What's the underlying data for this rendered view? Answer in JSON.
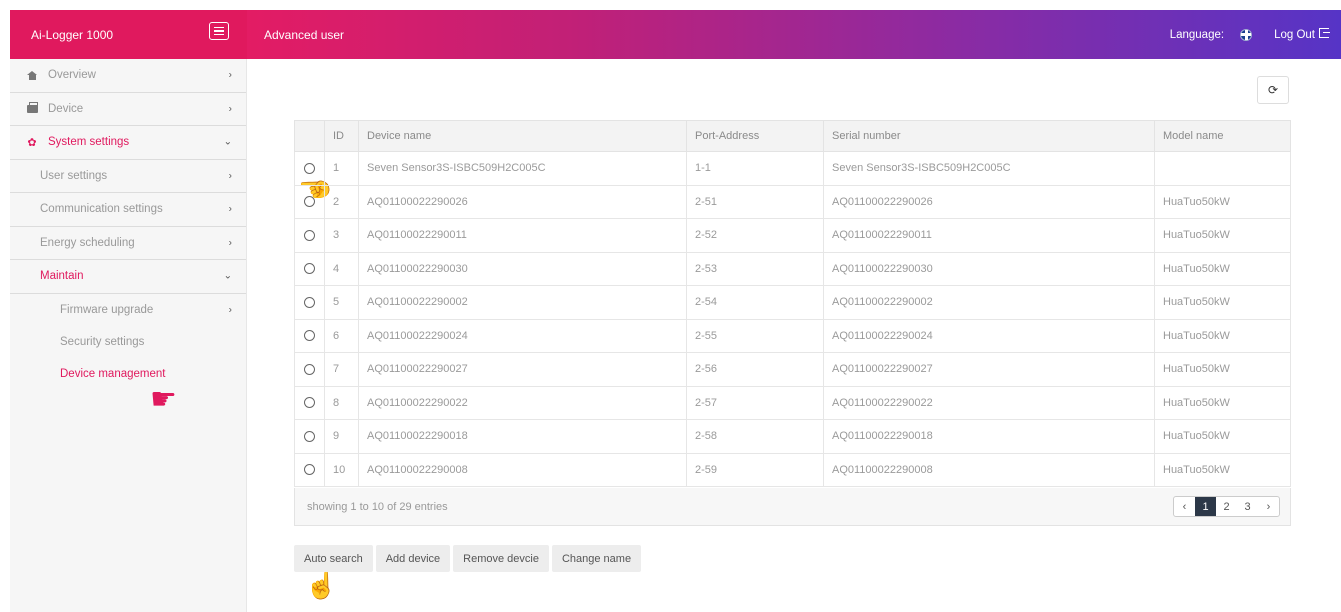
{
  "header": {
    "brand": "Ai-Logger 1000",
    "user_role": "Advanced user",
    "language_label": "Language:",
    "logout_label": "Log Out"
  },
  "sidebar": {
    "items": [
      {
        "label": "Overview"
      },
      {
        "label": "Device"
      },
      {
        "label": "System settings"
      },
      {
        "label": "User settings"
      },
      {
        "label": "Communication settings"
      },
      {
        "label": "Energy scheduling"
      },
      {
        "label": "Maintain"
      },
      {
        "label": "Firmware upgrade"
      },
      {
        "label": "Security settings"
      },
      {
        "label": "Device management"
      }
    ]
  },
  "table": {
    "columns": [
      "ID",
      "Device name",
      "Port-Address",
      "Serial number",
      "Model name"
    ],
    "rows": [
      {
        "id": "1",
        "name": "Seven Sensor3S-ISBC509H2C005C",
        "port": "1-1",
        "serial": "Seven Sensor3S-ISBC509H2C005C",
        "model": ""
      },
      {
        "id": "2",
        "name": "AQ01100022290026",
        "port": "2-51",
        "serial": "AQ01100022290026",
        "model": "HuaTuo50kW"
      },
      {
        "id": "3",
        "name": "AQ01100022290011",
        "port": "2-52",
        "serial": "AQ01100022290011",
        "model": "HuaTuo50kW"
      },
      {
        "id": "4",
        "name": "AQ01100022290030",
        "port": "2-53",
        "serial": "AQ01100022290030",
        "model": "HuaTuo50kW"
      },
      {
        "id": "5",
        "name": "AQ01100022290002",
        "port": "2-54",
        "serial": "AQ01100022290002",
        "model": "HuaTuo50kW"
      },
      {
        "id": "6",
        "name": "AQ01100022290024",
        "port": "2-55",
        "serial": "AQ01100022290024",
        "model": "HuaTuo50kW"
      },
      {
        "id": "7",
        "name": "AQ01100022290027",
        "port": "2-56",
        "serial": "AQ01100022290027",
        "model": "HuaTuo50kW"
      },
      {
        "id": "8",
        "name": "AQ01100022290022",
        "port": "2-57",
        "serial": "AQ01100022290022",
        "model": "HuaTuo50kW"
      },
      {
        "id": "9",
        "name": "AQ01100022290018",
        "port": "2-58",
        "serial": "AQ01100022290018",
        "model": "HuaTuo50kW"
      },
      {
        "id": "10",
        "name": "AQ01100022290008",
        "port": "2-59",
        "serial": "AQ01100022290008",
        "model": "HuaTuo50kW"
      }
    ]
  },
  "pagination": {
    "summary": "showing 1 to 10 of 29 entries",
    "prev": "‹",
    "pages": [
      "1",
      "2",
      "3"
    ],
    "next": "›",
    "current": "1"
  },
  "actions": {
    "auto_search": "Auto search",
    "add_device": "Add device",
    "remove_device": "Remove devcie",
    "change_name": "Change name"
  },
  "icons": {
    "refresh": "refresh-icon",
    "menu": "hamburger-icon",
    "flag": "uk-flag-icon",
    "logout": "logout-icon",
    "pointer": "hand-pointer-icon"
  },
  "colors": {
    "brand": "#e0195e",
    "gradient_end": "#5634c6",
    "active_page": "#2c3848"
  }
}
